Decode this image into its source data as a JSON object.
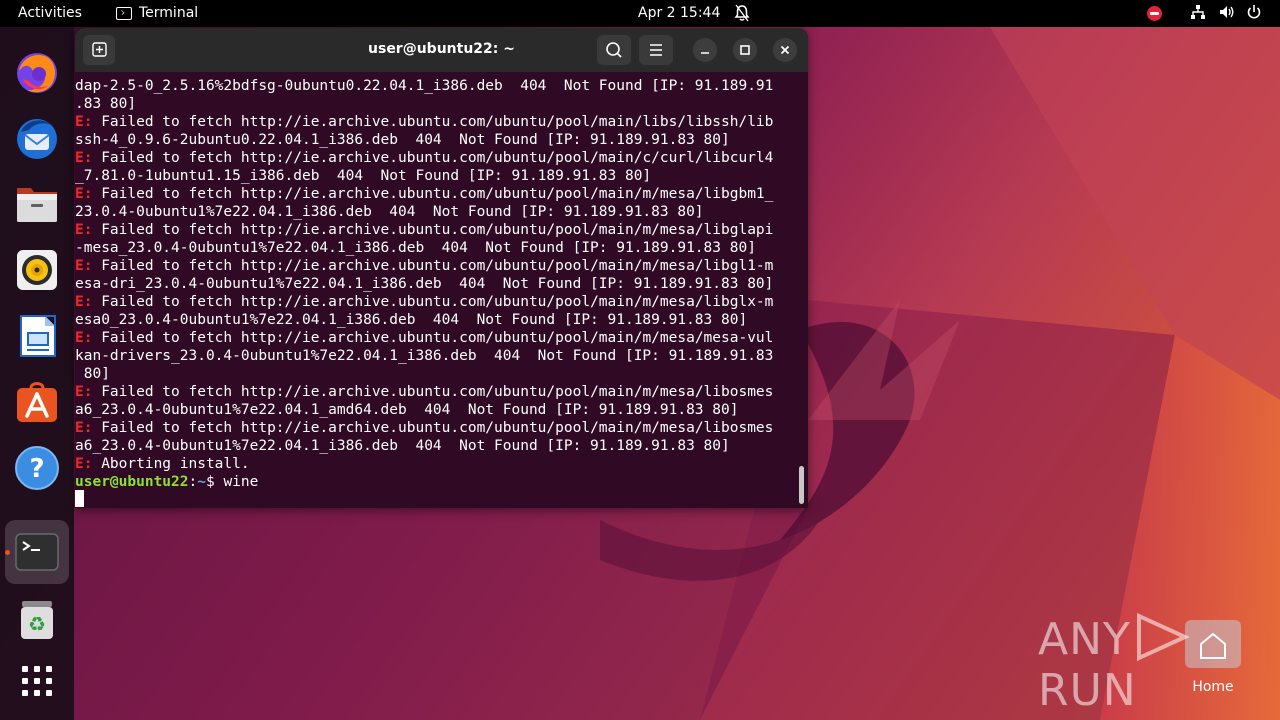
{
  "topbar": {
    "activities": "Activities",
    "app_name": "Terminal",
    "clock": "Apr 2  15:44"
  },
  "dock": {
    "items": [
      "firefox-icon",
      "thunderbird-icon",
      "files-icon",
      "rhythmbox-icon",
      "writer-icon",
      "app-center-icon",
      "help-icon",
      "terminal-icon",
      "trash-icon",
      "show-apps-icon"
    ]
  },
  "terminal": {
    "title": "user@ubuntu22: ~",
    "error_prefix": "E:",
    "lines": [
      {
        "prefix": "",
        "text": "dap-2.5-0_2.5.16%2bdfsg-0ubuntu0.22.04.1_i386.deb  404  Not Found [IP: 91.189.91"
      },
      {
        "prefix": "",
        "text": ".83 80]"
      },
      {
        "prefix": "E:",
        "text": " Failed to fetch http://ie.archive.ubuntu.com/ubuntu/pool/main/libs/libssh/lib"
      },
      {
        "prefix": "",
        "text": "ssh-4_0.9.6-2ubuntu0.22.04.1_i386.deb  404  Not Found [IP: 91.189.91.83 80]"
      },
      {
        "prefix": "E:",
        "text": " Failed to fetch http://ie.archive.ubuntu.com/ubuntu/pool/main/c/curl/libcurl4"
      },
      {
        "prefix": "",
        "text": "_7.81.0-1ubuntu1.15_i386.deb  404  Not Found [IP: 91.189.91.83 80]"
      },
      {
        "prefix": "E:",
        "text": " Failed to fetch http://ie.archive.ubuntu.com/ubuntu/pool/main/m/mesa/libgbm1_"
      },
      {
        "prefix": "",
        "text": "23.0.4-0ubuntu1%7e22.04.1_i386.deb  404  Not Found [IP: 91.189.91.83 80]"
      },
      {
        "prefix": "E:",
        "text": " Failed to fetch http://ie.archive.ubuntu.com/ubuntu/pool/main/m/mesa/libglapi"
      },
      {
        "prefix": "",
        "text": "-mesa_23.0.4-0ubuntu1%7e22.04.1_i386.deb  404  Not Found [IP: 91.189.91.83 80]"
      },
      {
        "prefix": "E:",
        "text": " Failed to fetch http://ie.archive.ubuntu.com/ubuntu/pool/main/m/mesa/libgl1-m"
      },
      {
        "prefix": "",
        "text": "esa-dri_23.0.4-0ubuntu1%7e22.04.1_i386.deb  404  Not Found [IP: 91.189.91.83 80]"
      },
      {
        "prefix": "E:",
        "text": " Failed to fetch http://ie.archive.ubuntu.com/ubuntu/pool/main/m/mesa/libglx-m"
      },
      {
        "prefix": "",
        "text": "esa0_23.0.4-0ubuntu1%7e22.04.1_i386.deb  404  Not Found [IP: 91.189.91.83 80]"
      },
      {
        "prefix": "E:",
        "text": " Failed to fetch http://ie.archive.ubuntu.com/ubuntu/pool/main/m/mesa/mesa-vul"
      },
      {
        "prefix": "",
        "text": "kan-drivers_23.0.4-0ubuntu1%7e22.04.1_i386.deb  404  Not Found [IP: 91.189.91.83"
      },
      {
        "prefix": "",
        "text": " 80]"
      },
      {
        "prefix": "E:",
        "text": " Failed to fetch http://ie.archive.ubuntu.com/ubuntu/pool/main/m/mesa/libosmes"
      },
      {
        "prefix": "",
        "text": "a6_23.0.4-0ubuntu1%7e22.04.1_amd64.deb  404  Not Found [IP: 91.189.91.83 80]"
      },
      {
        "prefix": "E:",
        "text": " Failed to fetch http://ie.archive.ubuntu.com/ubuntu/pool/main/m/mesa/libosmes"
      },
      {
        "prefix": "",
        "text": "a6_23.0.4-0ubuntu1%7e22.04.1_i386.deb  404  Not Found [IP: 91.189.91.83 80]"
      },
      {
        "prefix": "E:",
        "text": " Aborting install."
      }
    ],
    "prompt": {
      "user_host": "user@ubuntu22",
      "colon": ":",
      "path": "~",
      "dollar": "$ ",
      "command": "wine"
    }
  },
  "watermark": {
    "text": "ANY",
    "text2": "RUN"
  },
  "desktop": {
    "home_label": "Home"
  },
  "colors": {
    "terminal_bg": "#300a24",
    "error": "#ef2929",
    "prompt_user": "#8ae234",
    "prompt_path": "#729fcf",
    "accent": "#e95420"
  }
}
